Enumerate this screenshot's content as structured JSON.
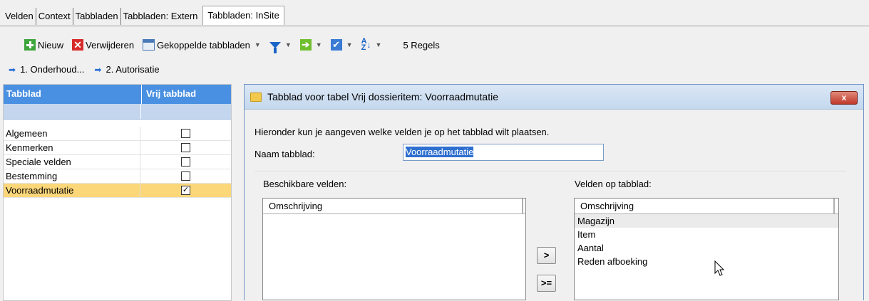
{
  "tabs": [
    "Velden",
    "Context",
    "Tabbladen",
    "Tabbladen: Extern",
    "Tabbladen: InSite"
  ],
  "toolbar": {
    "new_label": "Nieuw",
    "delete_label": "Verwijderen",
    "linked_label": "Gekoppelde tabbladen",
    "row_count": "5 Regels"
  },
  "nav": [
    "1. Onderhoud...",
    "2. Autorisatie"
  ],
  "grid": {
    "col1": "Tabblad",
    "col2": "Vrij tabblad",
    "rows": [
      {
        "name": "Algemeen",
        "checked": false
      },
      {
        "name": "Kenmerken",
        "checked": false
      },
      {
        "name": "Speciale velden",
        "checked": false
      },
      {
        "name": "Bestemming",
        "checked": false
      },
      {
        "name": "Voorraadmutatie",
        "checked": true
      }
    ]
  },
  "dialog": {
    "title": "Tabblad voor tabel Vrij dossieritem: Voorraadmutatie",
    "close": "x",
    "instruction": "Hieronder kun je aangeven welke velden je op het tabblad wilt plaatsen.",
    "name_label": "Naam tabblad:",
    "name_value": "Voorraadmutatie",
    "available_label": "Beschikbare velden:",
    "on_tab_label": "Velden op tabblad:",
    "available_header": "Omschrijving",
    "on_tab_header": "Omschrijving",
    "on_tab_items": [
      "Magazijn",
      "Item",
      "Aantal",
      "Reden afboeking"
    ],
    "move_one": ">",
    "move_all": ">="
  },
  "colors": {
    "grid_header": "#4a90e2",
    "selected_row": "#fbd77a"
  }
}
